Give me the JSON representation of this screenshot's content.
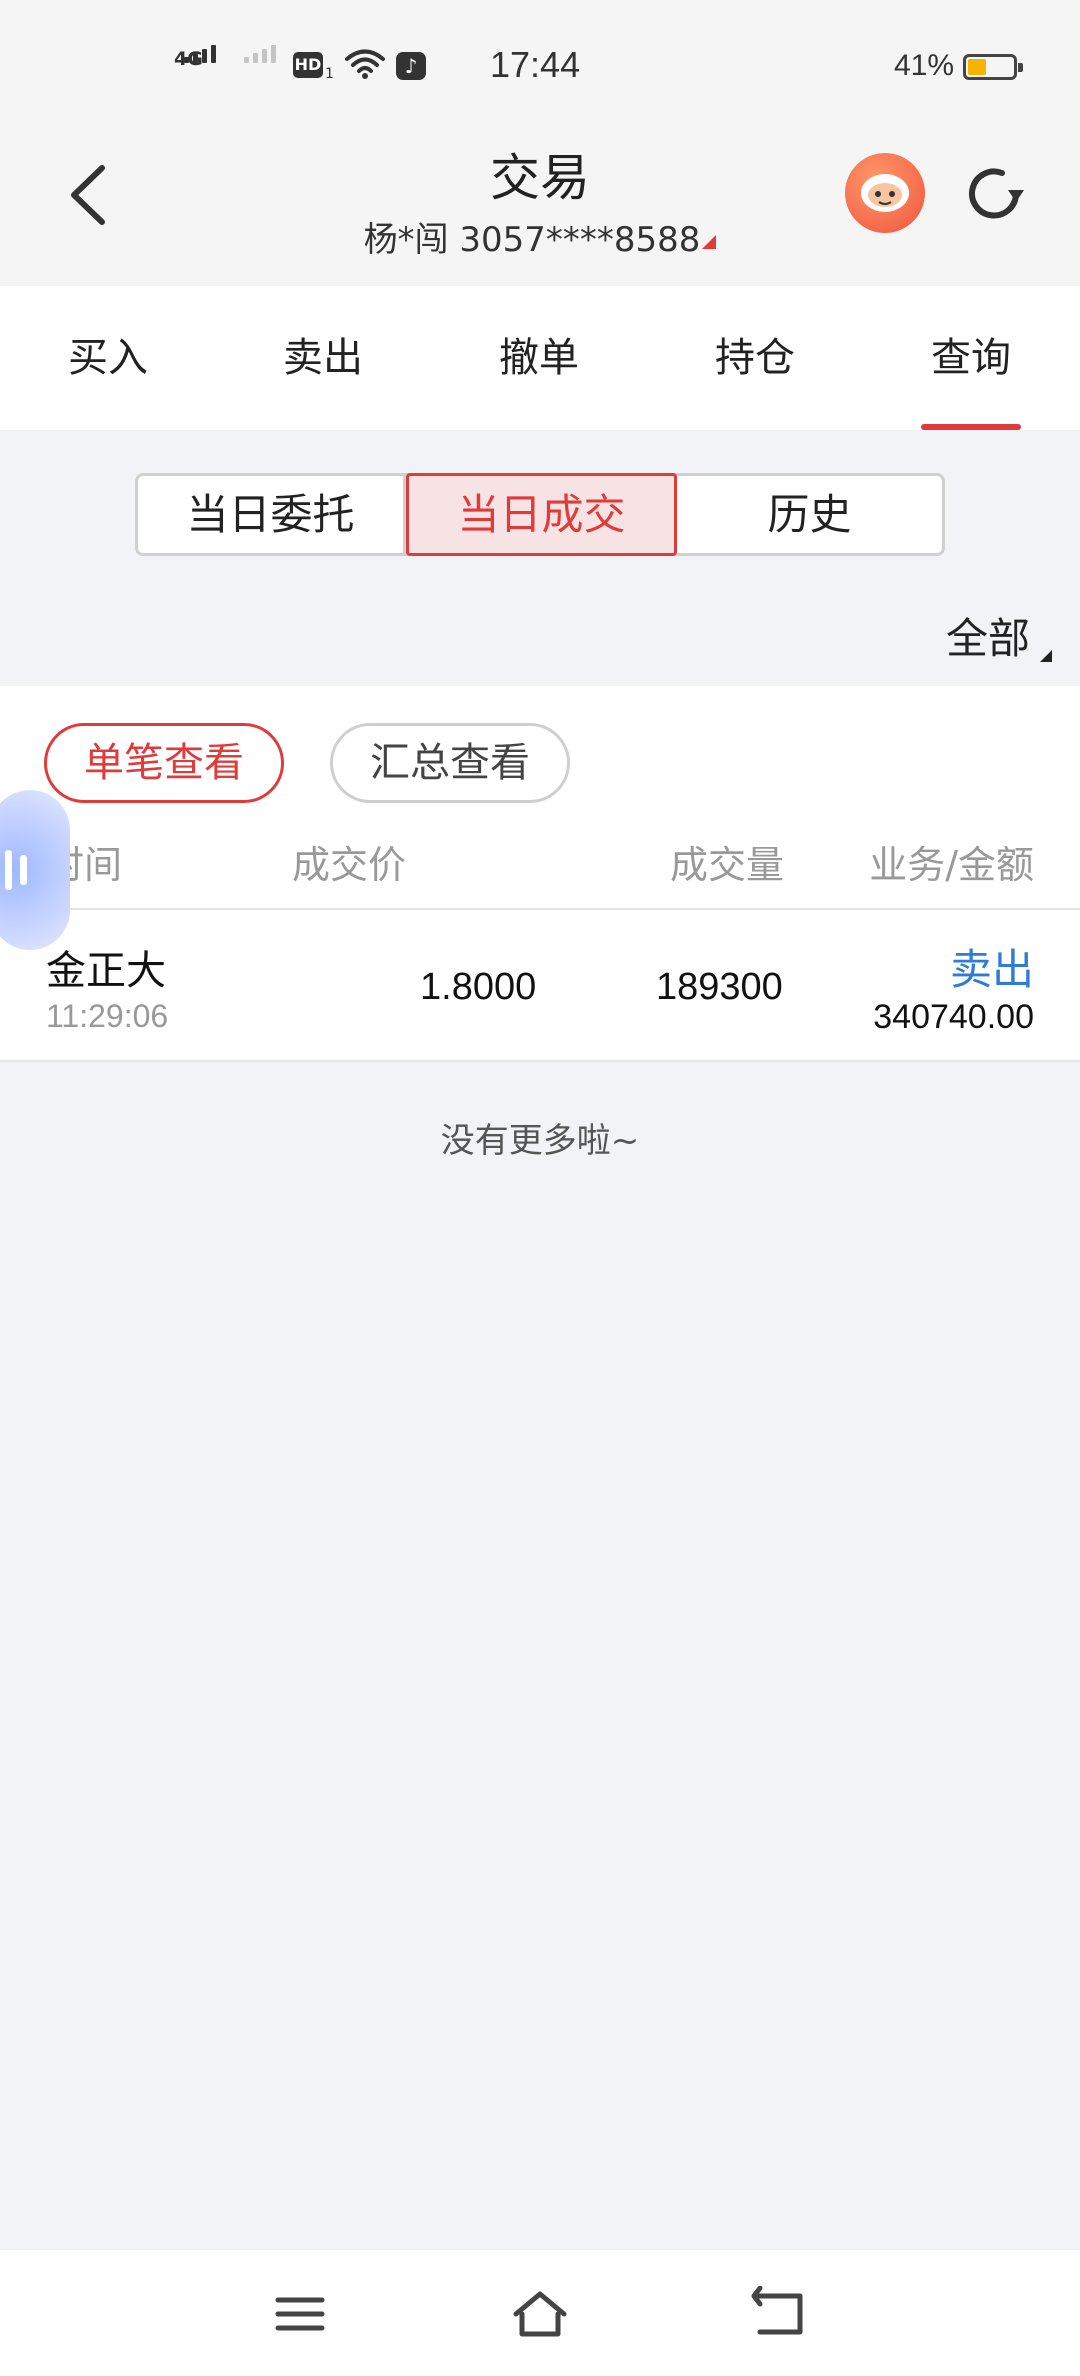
{
  "status_bar": {
    "network": "4G",
    "hd": "HD",
    "hd_sub": "1",
    "time": "17:44",
    "battery": "41%",
    "icons": [
      "signal-icon",
      "wifi-icon",
      "tiktok-icon",
      "battery-icon"
    ]
  },
  "header": {
    "title": "交易",
    "account": "杨*闯 3057****8588",
    "icons": [
      "back-arrow-icon",
      "assistant-robot-icon",
      "refresh-icon"
    ]
  },
  "tabs": [
    {
      "label": "买入"
    },
    {
      "label": "卖出"
    },
    {
      "label": "撤单"
    },
    {
      "label": "持仓"
    },
    {
      "label": "查询",
      "active": true
    }
  ],
  "segment": [
    {
      "label": "当日委托"
    },
    {
      "label": "当日成交",
      "active": true
    },
    {
      "label": "历史"
    }
  ],
  "filter": {
    "label": "全部"
  },
  "view_toggle": {
    "single": "单笔查看",
    "summary": "汇总查看"
  },
  "columns": {
    "time": "时间",
    "price": "成交价",
    "volume": "成交量",
    "business_amount": "业务/金额"
  },
  "trades": [
    {
      "name": "金正大",
      "time": "11:29:06",
      "price": "1.8000",
      "volume": "189300",
      "type": "卖出",
      "amount": "340740.00"
    }
  ],
  "no_more": "没有更多啦~",
  "colors": {
    "accent": "#e03a3a",
    "sell": "#2f7cd8",
    "background": "#f2f3f7"
  },
  "nav_icons": [
    "menu-icon",
    "home-icon",
    "back-icon"
  ]
}
